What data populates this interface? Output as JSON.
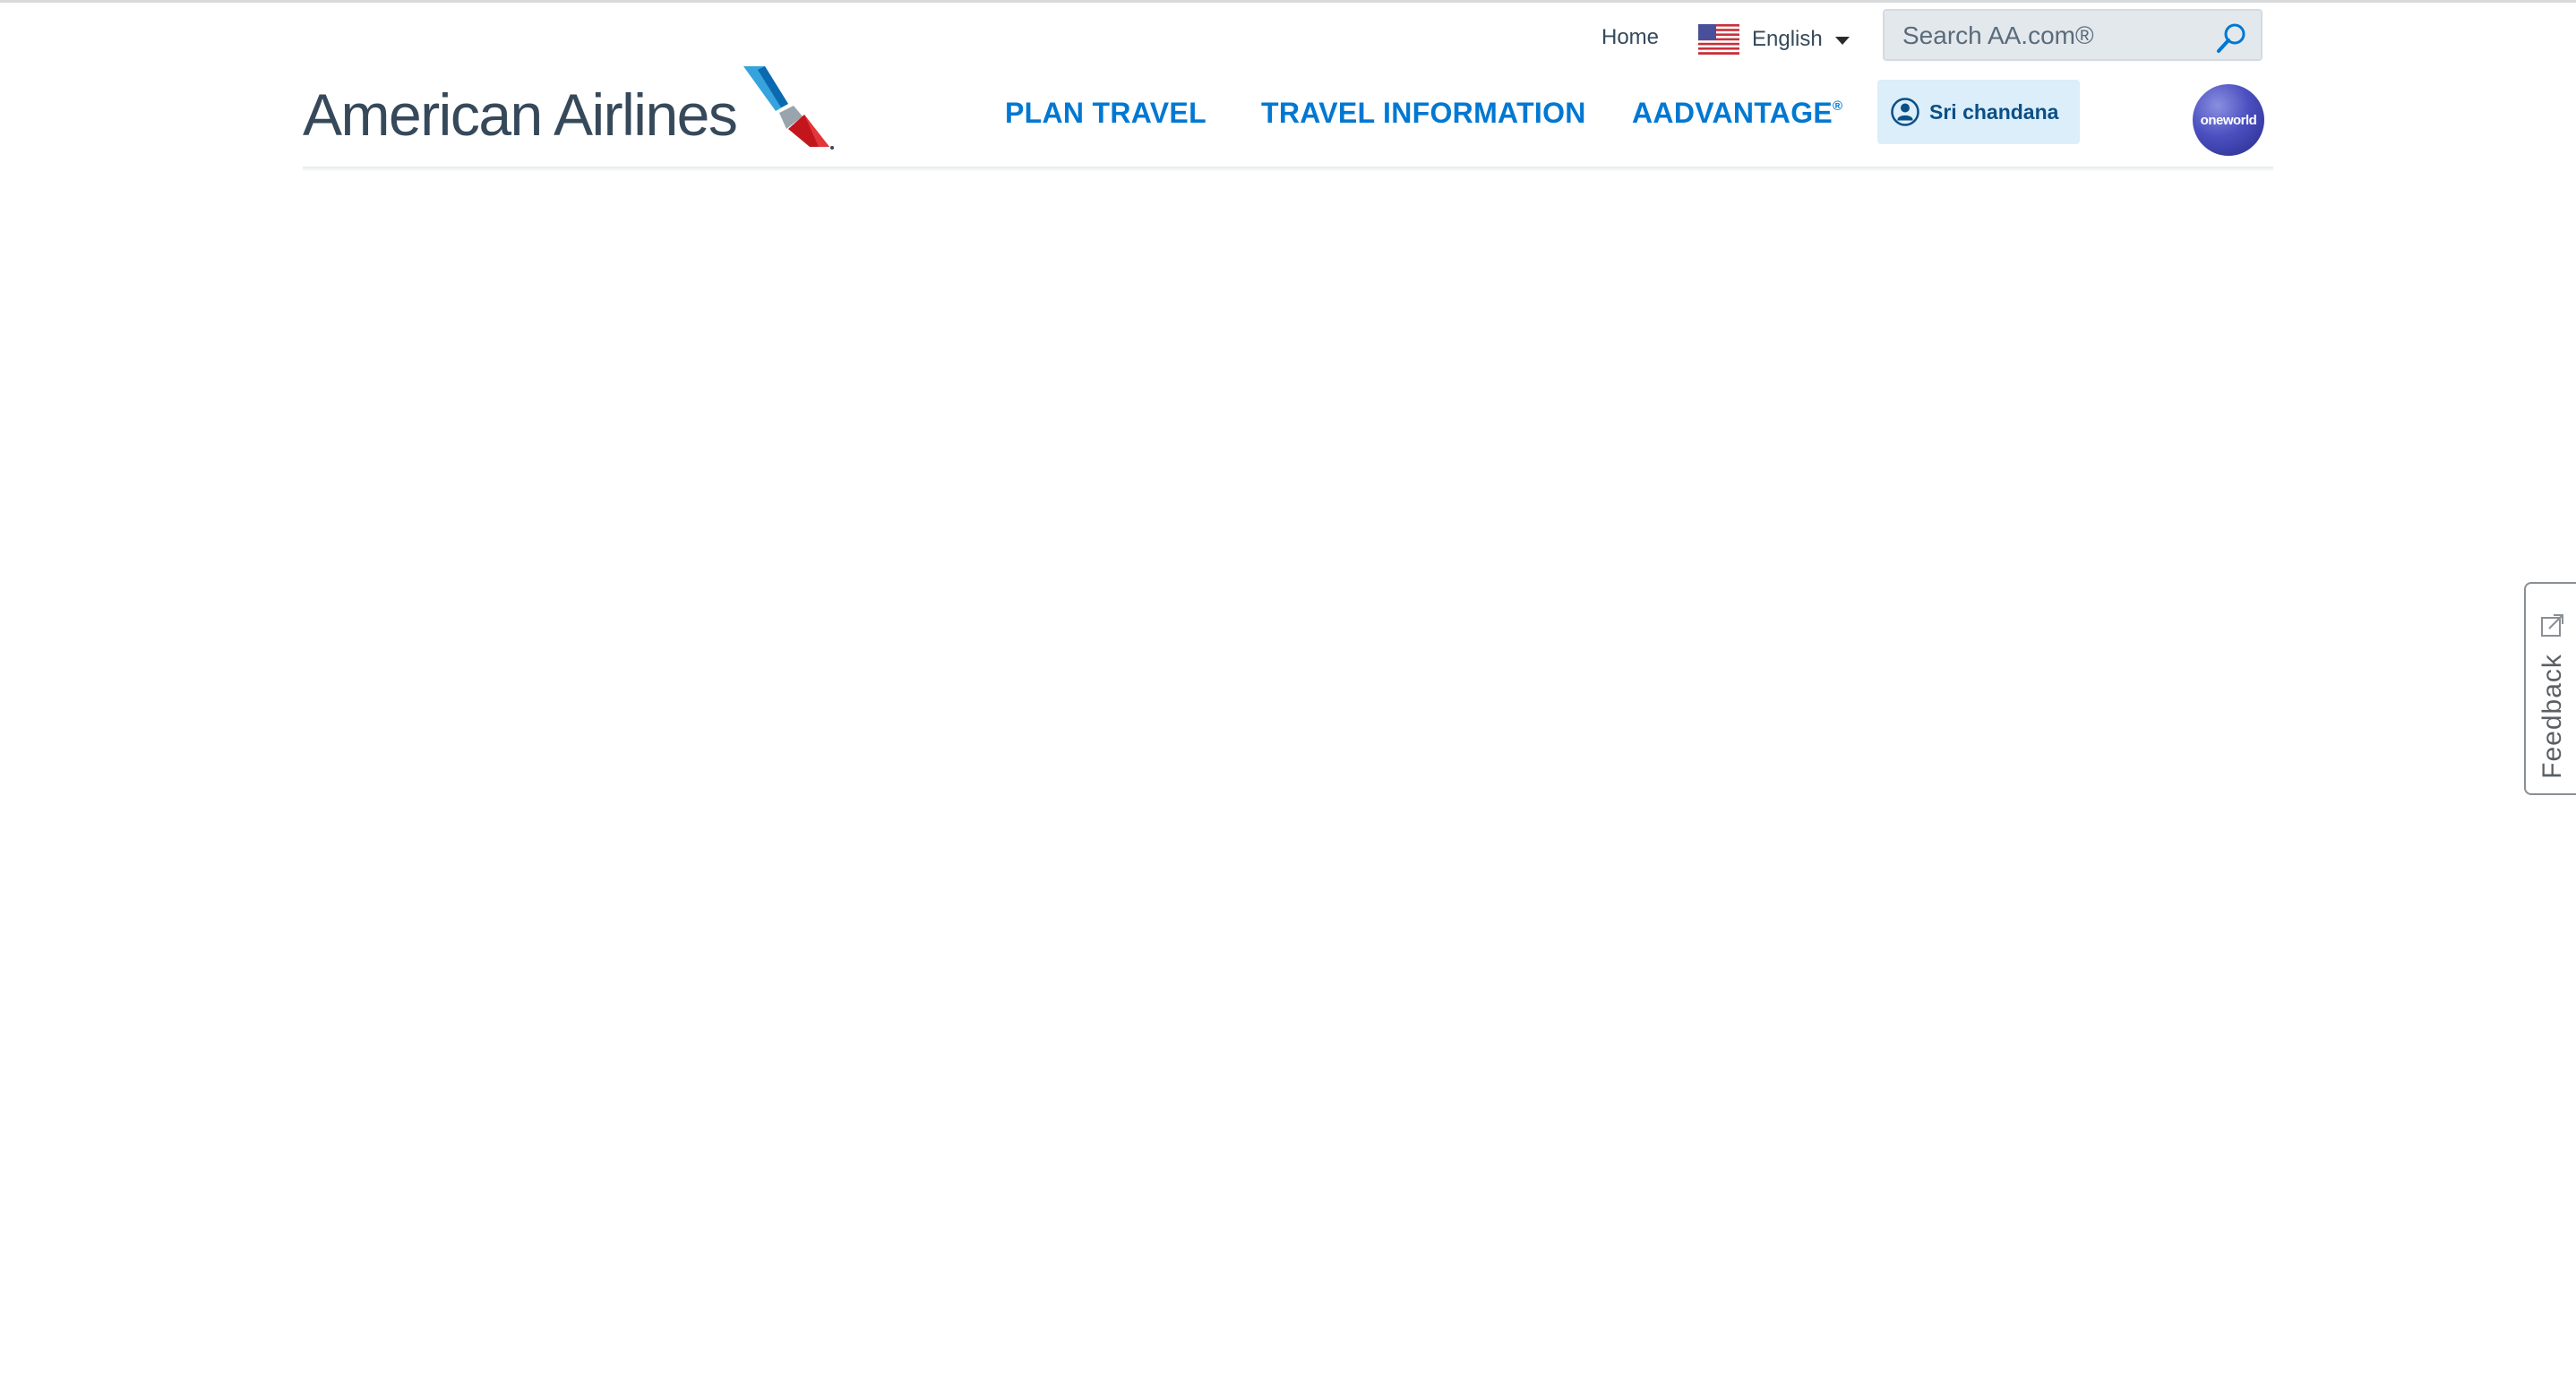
{
  "header": {
    "home_label": "Home",
    "language": {
      "label": "English",
      "flag_icon": "us-flag-icon"
    },
    "search": {
      "placeholder": "Search AA.com®",
      "icon": "search-icon"
    },
    "logo_text": "American Airlines",
    "nav": {
      "plan_travel": "PLAN TRAVEL",
      "travel_information": "TRAVEL INFORMATION",
      "aadvantage": "AADVANTAGE",
      "aadvantage_mark": "®"
    },
    "user": {
      "name": "Sri chandana",
      "icon": "user-icon"
    },
    "oneworld_label": "oneworld"
  },
  "feedback": {
    "label": "Feedback",
    "icon": "external-link-icon"
  },
  "colors": {
    "brand_blue": "#0078d2",
    "logo_gray": "#36495a",
    "user_bg": "#dbeefa",
    "search_bg": "#e3e8ed"
  }
}
